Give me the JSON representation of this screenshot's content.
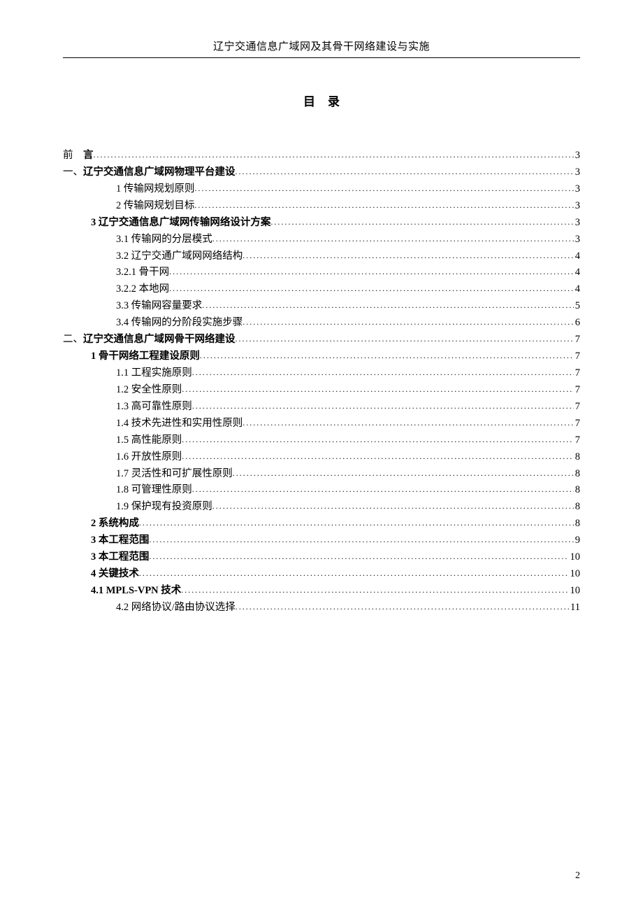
{
  "header_title": "辽宁交通信息广域网及其骨干网络建设与实施",
  "toc_title": "目录",
  "page_number": "2",
  "dots": "..........................................................................................................................................................................................................",
  "entries": [
    {
      "pre": "前　",
      "label": "言",
      "page": "3",
      "indent": 0,
      "style": "bold-first"
    },
    {
      "pre": "一、",
      "label": "辽宁交通信息广域网物理平台建设 ",
      "page": "3",
      "indent": 0,
      "style": "bold-first"
    },
    {
      "pre": "",
      "label": "1 传输网规划原则",
      "page": "3",
      "indent": 2,
      "style": ""
    },
    {
      "pre": "",
      "label": "2 传输网规划目标",
      "page": "3",
      "indent": 2,
      "style": ""
    },
    {
      "pre": "",
      "label": "3 辽宁交通信息广域网传输网络设计方案 ",
      "page": "3",
      "indent": 1,
      "style": "bold"
    },
    {
      "pre": "",
      "label": "3.1 传输网的分层模式",
      "page": "3",
      "indent": 2,
      "style": ""
    },
    {
      "pre": "",
      "label": "3.2 辽宁交通广域网网络结构",
      "page": "4",
      "indent": 2,
      "style": ""
    },
    {
      "pre": "",
      "label": "3.2.1 骨干网",
      "page": "4",
      "indent": 2,
      "style": ""
    },
    {
      "pre": "",
      "label": "3.2.2 本地网",
      "page": "4",
      "indent": 2,
      "style": ""
    },
    {
      "pre": "",
      "label": "3.3 传输网容量要求",
      "page": "5",
      "indent": 2,
      "style": ""
    },
    {
      "pre": "",
      "label": "3.4 传输网的分阶段实施步骤",
      "page": "6",
      "indent": 2,
      "style": ""
    },
    {
      "pre": "二、",
      "label": "辽宁交通信息广域网骨干网络建设",
      "page": "7",
      "indent": 0,
      "style": "bold-first"
    },
    {
      "pre": "",
      "label": "1 骨干网络工程建设原则 ",
      "page": "7",
      "indent": 1,
      "style": "bold"
    },
    {
      "pre": "",
      "label": "1.1 工程实施原则",
      "page": "7",
      "indent": 2,
      "style": ""
    },
    {
      "pre": "",
      "label": "1.2 安全性原则",
      "page": "7",
      "indent": 2,
      "style": ""
    },
    {
      "pre": "",
      "label": "1.3 高可靠性原则",
      "page": "7",
      "indent": 2,
      "style": ""
    },
    {
      "pre": "",
      "label": "1.4 技术先进性和实用性原则",
      "page": "7",
      "indent": 2,
      "style": ""
    },
    {
      "pre": "",
      "label": "1.5 高性能原则",
      "page": "7",
      "indent": 2,
      "style": ""
    },
    {
      "pre": "",
      "label": "1.6 开放性原则",
      "page": "8",
      "indent": 2,
      "style": ""
    },
    {
      "pre": "",
      "label": "1.7 灵活性和可扩展性原则",
      "page": "8",
      "indent": 2,
      "style": ""
    },
    {
      "pre": "",
      "label": "1.8 可管理性原则",
      "page": "8",
      "indent": 2,
      "style": ""
    },
    {
      "pre": "",
      "label": "1.9 保护现有投资原则",
      "page": "8",
      "indent": 2,
      "style": ""
    },
    {
      "pre": "",
      "label": "2 系统构成",
      "page": "8",
      "indent": 1,
      "style": "bold"
    },
    {
      "pre": "",
      "label": "3 本工程范围",
      "page": "9",
      "indent": 1,
      "style": "bold"
    },
    {
      "pre": "",
      "label": "3 本工程范围",
      "page": "10",
      "indent": 1,
      "style": "bold"
    },
    {
      "pre": "",
      "label": "4 关键技术",
      "page": "10",
      "indent": 1,
      "style": "bold"
    },
    {
      "pre": "",
      "label": "4.1 MPLS-VPN 技术 ",
      "page": "10",
      "indent": 1,
      "style": "bold"
    },
    {
      "pre": "",
      "label": "4.2 网络协议/路由协议选择",
      "page": "11",
      "indent": 2,
      "style": ""
    }
  ]
}
